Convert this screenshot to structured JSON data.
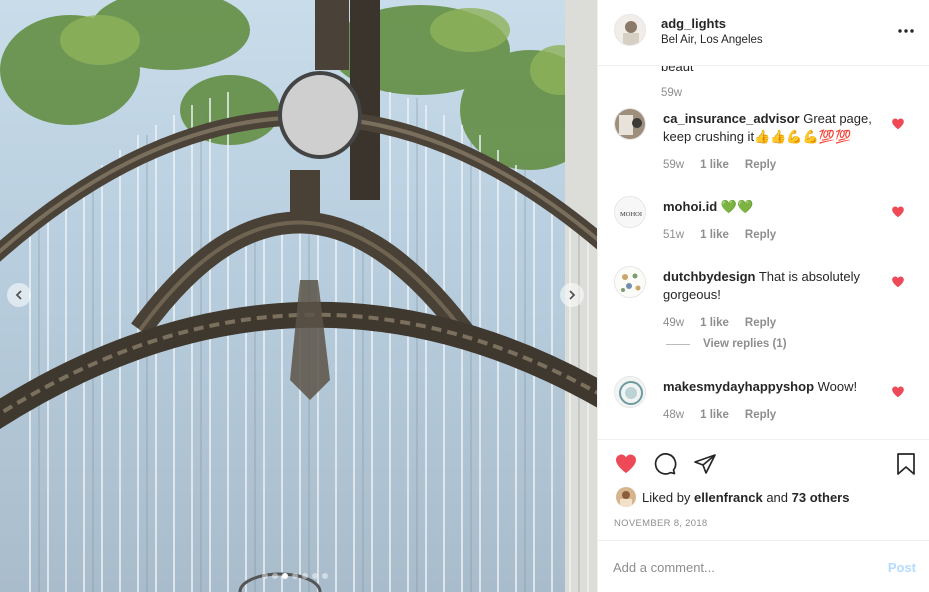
{
  "post": {
    "owner": "adg_lights",
    "location": "Bel Air, Los Angeles",
    "carousel_slides": 7,
    "carousel_active_index": 2
  },
  "comments": {
    "previous_cut_text": "beaut",
    "previous_meta_age": "59w",
    "items": [
      {
        "user": "ca_insurance_advisor",
        "text": "Great page, keep crushing it👍👍💪💪💯💯",
        "age": "59w",
        "likes": "1 like",
        "reply": "Reply",
        "avatar": "photo"
      },
      {
        "user": "mohoi.id",
        "text": "💚💚",
        "age": "51w",
        "likes": "1 like",
        "reply": "Reply",
        "avatar": "MOHOI"
      },
      {
        "user": "dutchbydesign",
        "text": "That is absolutely gorgeous!",
        "age": "49w",
        "likes": "1 like",
        "reply": "Reply",
        "avatar": "pattern",
        "view_replies": "View replies (1)"
      },
      {
        "user": "makesmydayhappyshop",
        "text": "Woow!",
        "age": "48w",
        "likes": "1 like",
        "reply": "Reply",
        "avatar": "circle"
      }
    ]
  },
  "likes": {
    "prefix": "Liked by",
    "first_user": "ellenfranck",
    "joiner": "and",
    "others": "73 others"
  },
  "date": "NOVEMBER 8, 2018",
  "add_comment": {
    "placeholder": "Add a comment...",
    "post_label": "Post"
  },
  "colors": {
    "heart": "#ed4956",
    "post_disabled": "#b3dbff",
    "meta": "#8e8e8e"
  },
  "icons": [
    "more-options-icon",
    "heart-icon",
    "comment-icon",
    "share-icon",
    "bookmark-icon",
    "chevron-left-icon",
    "chevron-right-icon"
  ]
}
